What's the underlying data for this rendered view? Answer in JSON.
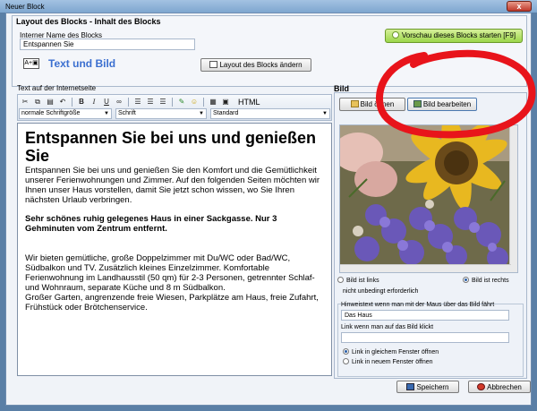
{
  "window": {
    "title": "Neuer Block",
    "close_label": "x"
  },
  "header": {
    "group_title": "Layout des Blocks - Inhalt des Blocks",
    "name_label": "Interner Name des Blocks",
    "name_value": "Entspannen Sie",
    "preview_button": "Vorschau dieses Blocks starten [F9]",
    "type_icon": "A+▣",
    "type_label": "Text und Bild",
    "change_layout_button": "Layout des Blocks ändern"
  },
  "editor": {
    "title": "Text auf der Internetseite",
    "html_label": "HTML",
    "font_size": "normale Schriftgröße",
    "font": "Schrift",
    "style": "Standard",
    "heading": "Entspannen Sie bei uns und genießen Sie",
    "p1": "Entspannen Sie bei uns und genießen Sie den Komfort und die Gemütlichkeit unserer Ferienwohnungen und Zimmer. Auf den folgenden Seiten möchten wir Ihnen unser Haus vorstellen, damit Sie jetzt schon wissen, wo Sie Ihren nächsten Urlaub verbringen.",
    "bold": "Sehr schönes ruhig gelegenes Haus in einer Sackgasse. Nur 3 Gehminuten vom Zentrum entfernt.",
    "p2": "Wir bieten gemütliche, große Doppelzimmer mit Du/WC oder Bad/WC, Südbalkon und TV. Zusätzlich kleines Einzelzimmer. Komfortable Ferienwohnung im Landhausstil (50 qm) für 2-3 Personen, getrennter Schlaf- und Wohnraum, separate Küche und 8 m Südbalkon.",
    "p3": "Großer Garten, angrenzende freie Wiesen, Parkplätze am Haus, freie Zufahrt, Frühstück oder Brötchenservice."
  },
  "bild": {
    "title": "Bild",
    "open_button": "Bild öffnen",
    "edit_button": "Bild bearbeiten",
    "left_label": "Bild ist links",
    "right_label": "Bild ist rechts",
    "optional_label": "nicht unbedingt erforderlich",
    "hint_label": "Hinweistext wenn man mit der Maus über das Bild fährt",
    "hint_value": "Das Haus",
    "link_label": "Link wenn man auf das Bild klickt",
    "link_value": "",
    "same_window": "Link in gleichem Fenster öffnen",
    "new_window": "Link in neuem Fenster öffnen"
  },
  "footer": {
    "save": "Speichern",
    "cancel": "Abbrechen"
  },
  "colors": {
    "annotation": "#e8141b",
    "accent": "#3b6fd0",
    "preview_green": "#9cd64a"
  }
}
